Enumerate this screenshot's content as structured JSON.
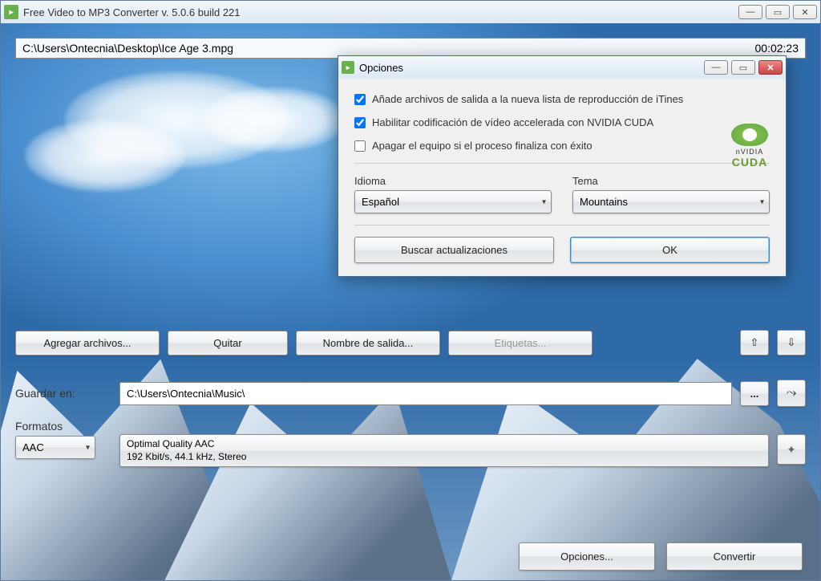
{
  "app": {
    "title": "Free Video to MP3 Converter  v. 5.0.6 build 221"
  },
  "file": {
    "path": "C:\\Users\\Ontecnia\\Desktop\\Ice Age 3.mpg",
    "duration": "00:02:23"
  },
  "buttons": {
    "add": "Agregar archivos...",
    "remove": "Quitar",
    "rename": "Nombre de salida...",
    "tags": "Etiquetas..."
  },
  "save": {
    "label": "Guardar en:",
    "path": "C:\\Users\\Ontecnia\\Music\\"
  },
  "formats": {
    "label": "Formatos",
    "codec": "AAC",
    "quality_title": "Optimal Quality AAC",
    "quality_detail": "192 Kbit/s, 44.1 kHz, Stereo"
  },
  "bottom": {
    "options": "Opciones...",
    "convert": "Convertir"
  },
  "modal": {
    "title": "Opciones",
    "check1": "Añade archivos de salida a la nueva lista de reproducción de iTines",
    "check2": "Habilitar codificación de vídeo accelerada con NVIDIA CUDA",
    "check3": "Apagar el equipo si el proceso finaliza con éxito",
    "lang_label": "Idioma",
    "lang_value": "Español",
    "theme_label": "Tema",
    "theme_value": "Mountains",
    "updates": "Buscar actualizaciones",
    "ok": "OK",
    "cuda_brand1": "nVIDIA",
    "cuda_brand2": "CUDA"
  }
}
